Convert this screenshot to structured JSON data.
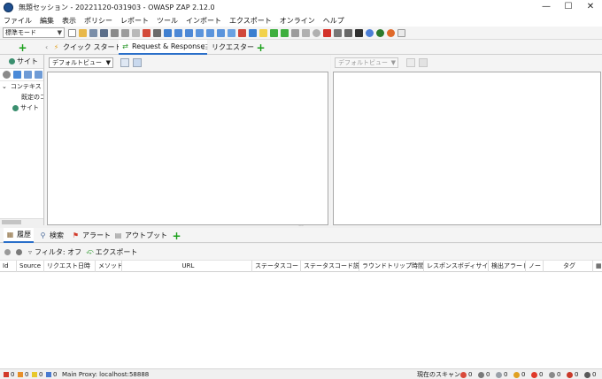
{
  "window": {
    "title": "無題セッション - 20221120-031903 - OWASP ZAP 2.12.0"
  },
  "menu": [
    "ファイル",
    "編集",
    "表示",
    "ポリシー",
    "レポート",
    "ツール",
    "インポート",
    "エクスポート",
    "オンライン",
    "ヘルプ"
  ],
  "toolbar": {
    "mode": "標準モード"
  },
  "top_tabs": {
    "quick_start": "クイック スタート",
    "request_response": "Request & Response",
    "requester": "リクエスター"
  },
  "sites": {
    "tab": "サイト",
    "tree": [
      "コンテキスト",
      "既定のコンテキスト",
      "サイト"
    ]
  },
  "request": {
    "view": "デフォルトビュー"
  },
  "response": {
    "view": "デフォルトビュー"
  },
  "bottom_tabs": {
    "history": "履歴",
    "search": "検索",
    "alerts": "アラート",
    "output": "アウトプット"
  },
  "filter": {
    "label": "フィルタ: オフ",
    "export": "エクスポート"
  },
  "history_columns": [
    "Id",
    "Source",
    "リクエスト日時",
    "メソッド",
    "URL",
    "ステータスコード",
    "ステータスコード説明",
    "ラウンドトリップ時間",
    "レスポンスボディサイズ",
    "検出アラート",
    "ノート",
    "タグ"
  ],
  "status": {
    "alerts": [
      "0",
      "0",
      "0",
      "0"
    ],
    "proxy": "Main Proxy: localhost:58888",
    "current_scans_label": "現在のスキャン",
    "scans": [
      "0",
      "0",
      "0",
      "0",
      "0",
      "0",
      "0",
      "0"
    ]
  },
  "colors": {
    "accent": "#2a6fc9",
    "add_green": "#1aa01a"
  }
}
